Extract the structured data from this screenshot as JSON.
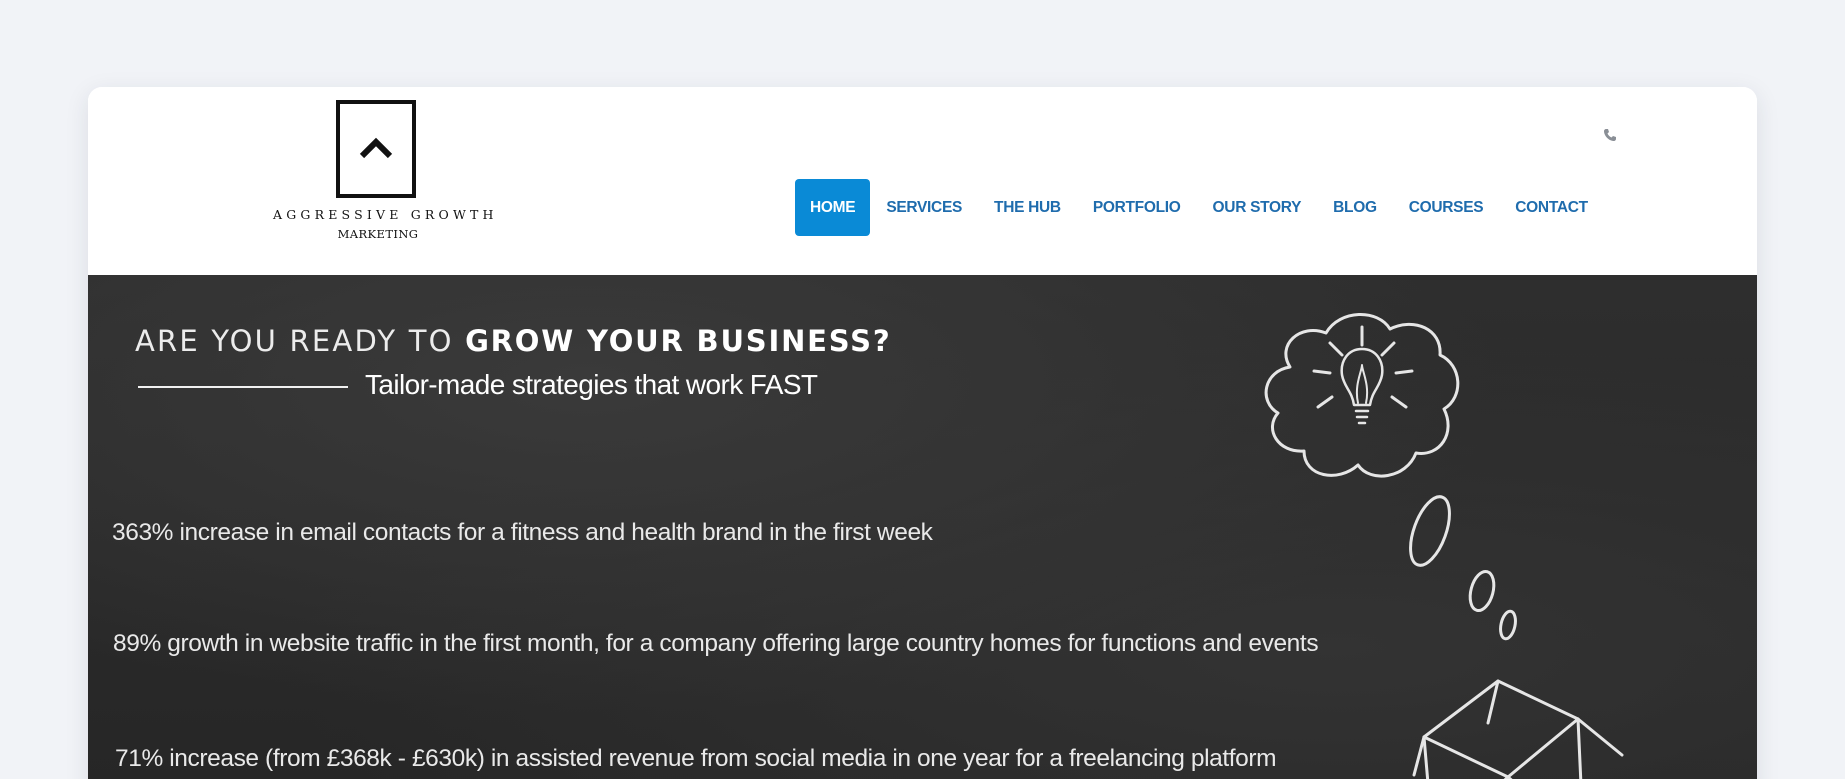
{
  "logo": {
    "name_line1": "AGGRESSIVE GROWTH",
    "name_line2": "MARKETING"
  },
  "header": {
    "phone_icon": "phone-icon"
  },
  "nav": {
    "items": [
      {
        "label": "HOME",
        "active": true
      },
      {
        "label": "SERVICES",
        "active": false
      },
      {
        "label": "THE HUB",
        "active": false
      },
      {
        "label": "PORTFOLIO",
        "active": false
      },
      {
        "label": "OUR STORY",
        "active": false
      },
      {
        "label": "BLOG",
        "active": false
      },
      {
        "label": "COURSES",
        "active": false
      },
      {
        "label": "CONTACT",
        "active": false
      }
    ],
    "active_color": "#0a8ad6",
    "link_color": "#1f6cad"
  },
  "hero": {
    "headline_light": "ARE YOU READY TO ",
    "headline_bold": "GROW YOUR BUSINESS?",
    "subheadline": "Tailor-made strategies that work FAST",
    "stats": [
      "363% increase in email contacts for a fitness and health brand in the first week",
      "89% growth in website traffic in the first month, for a company offering large country homes for functions and events",
      "71% increase (from £368k - £630k) in assisted revenue from social media in one year for a freelancing platform"
    ],
    "illustration": "chalk-thought-bubble-lightbulb-box"
  }
}
